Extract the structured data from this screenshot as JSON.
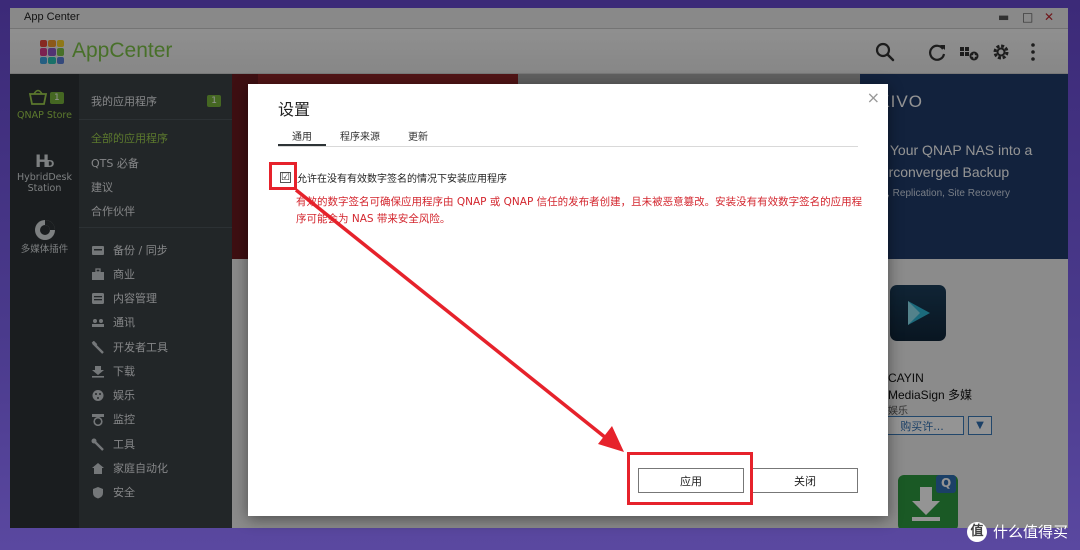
{
  "window": {
    "title": "App Center",
    "controls": {
      "minimize": "▬",
      "maximize": "□",
      "close": "✕"
    }
  },
  "header": {
    "app_name": "AppCenter",
    "icons": [
      "search-icon",
      "refresh-icon",
      "install-manual-icon",
      "gear-icon",
      "more-icon"
    ]
  },
  "left_rail": {
    "items": [
      {
        "label": "QNAP Store",
        "badge": "1",
        "icon": "store-icon"
      },
      {
        "label": "HybridDesk Station",
        "icon": "hybriddesk-icon"
      },
      {
        "label": "多媒体插件",
        "icon": "multimedia-plugin-icon"
      }
    ]
  },
  "sidebar": {
    "my_apps": {
      "label": "我的应用程序",
      "badge": "1"
    },
    "group1": [
      {
        "label": "全部的应用程序",
        "active": true
      },
      {
        "label": "QTS 必备"
      },
      {
        "label": "建议"
      },
      {
        "label": "合作伙伴"
      }
    ],
    "categories": [
      {
        "label": "备份 / 同步",
        "icon": "backup-icon"
      },
      {
        "label": "商业",
        "icon": "business-icon"
      },
      {
        "label": "内容管理",
        "icon": "content-icon"
      },
      {
        "label": "通讯",
        "icon": "communication-icon"
      },
      {
        "label": "开发者工具",
        "icon": "developer-tools-icon"
      },
      {
        "label": "下载",
        "icon": "download-icon"
      },
      {
        "label": "娱乐",
        "icon": "entertainment-icon"
      },
      {
        "label": "监控",
        "icon": "surveillance-icon"
      },
      {
        "label": "工具",
        "icon": "tools-icon"
      },
      {
        "label": "家庭自动化",
        "icon": "home-automation-icon"
      },
      {
        "label": "安全",
        "icon": "security-icon"
      }
    ]
  },
  "banner": {
    "brand": "AKIVO",
    "line1": "urn Your QNAP NAS into a",
    "line2": "yperconverged Backup",
    "line3": "ckup, Replication, Site Recovery"
  },
  "app_card": {
    "name_line1": "CAYIN",
    "name_line2": "MediaSign 多媒",
    "category": "娱乐",
    "buy_label": "购买许...",
    "download_badge": "Q"
  },
  "dialog": {
    "title": "设置",
    "close": "×",
    "tabs": [
      {
        "label": "通用",
        "active": true
      },
      {
        "label": "程序来源"
      },
      {
        "label": "更新"
      }
    ],
    "option": {
      "checked": true,
      "check_mark": "☑",
      "label": "允许在没有有效数字签名的情况下安装应用程序"
    },
    "warning": "有效的数字签名可确保应用程序由 QNAP 或 QNAP 信任的发布者创建，且未被恶意篡改。安装没有有效数字签名的应用程序可能会为 NAS 带来安全风险。",
    "apply_label": "应用",
    "close_label": "关闭"
  },
  "watermark": {
    "icon_text": "值",
    "text": "什么值得买"
  },
  "colors": {
    "accent_green": "#7cc247",
    "highlight_red": "#e6222b",
    "warning_red": "#d3262e",
    "sidebar_dark": "#3b4246",
    "rail_dark": "#2d3336"
  }
}
